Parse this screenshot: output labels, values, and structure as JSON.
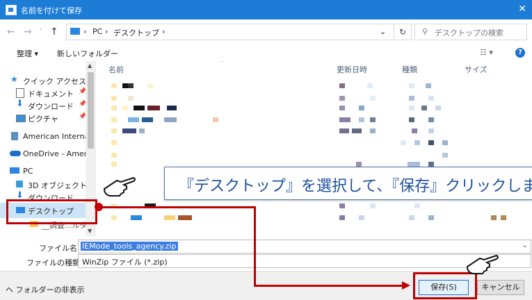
{
  "window": {
    "title": "名前を付けて保存"
  },
  "address": {
    "path": [
      "PC",
      "デスクトップ"
    ],
    "sep": "›",
    "search_placeholder": "デスクトップの検索"
  },
  "toolbar": {
    "organize": "整理 ▾",
    "new_folder": "新しいフォルダー"
  },
  "sidebar": {
    "items": [
      {
        "label": "クイック アクセス",
        "icon": "star-icon"
      },
      {
        "label": "ドキュメント",
        "icon": "document-icon"
      },
      {
        "label": "ダウンロード",
        "icon": "download-icon"
      },
      {
        "label": "ピクチャ",
        "icon": "picture-icon"
      },
      {
        "label": "American Internat",
        "icon": "building-icon"
      },
      {
        "label": "OneDrive - Americ",
        "icon": "cloud-icon"
      },
      {
        "label": "PC",
        "icon": "pc-icon"
      },
      {
        "label": "3D オブジェクト",
        "icon": "cube-icon"
      },
      {
        "label": "ダウンロード",
        "icon": "download-icon"
      },
      {
        "label": "デスクトップ",
        "icon": "desktop-icon"
      },
      {
        "label": "__調査...ルダ",
        "icon": "folder-icon"
      }
    ]
  },
  "columns": {
    "name": "名前",
    "date": "更新日時",
    "type": "種類",
    "size": "サイズ"
  },
  "form": {
    "filename_label": "ファイル名(N):",
    "filename_value": "IEMode_tools_agency.zip",
    "filetype_label": "ファイルの種類(T):",
    "filetype_value": "WinZip ファイル (*.zip)"
  },
  "buttons": {
    "hide_folders": "ヘ フォルダーの非表示",
    "save": "保存(S)",
    "cancel": "キャンセル"
  },
  "annotation": {
    "text": "『デスクトップ』を選択して、『保存』クリックします"
  }
}
